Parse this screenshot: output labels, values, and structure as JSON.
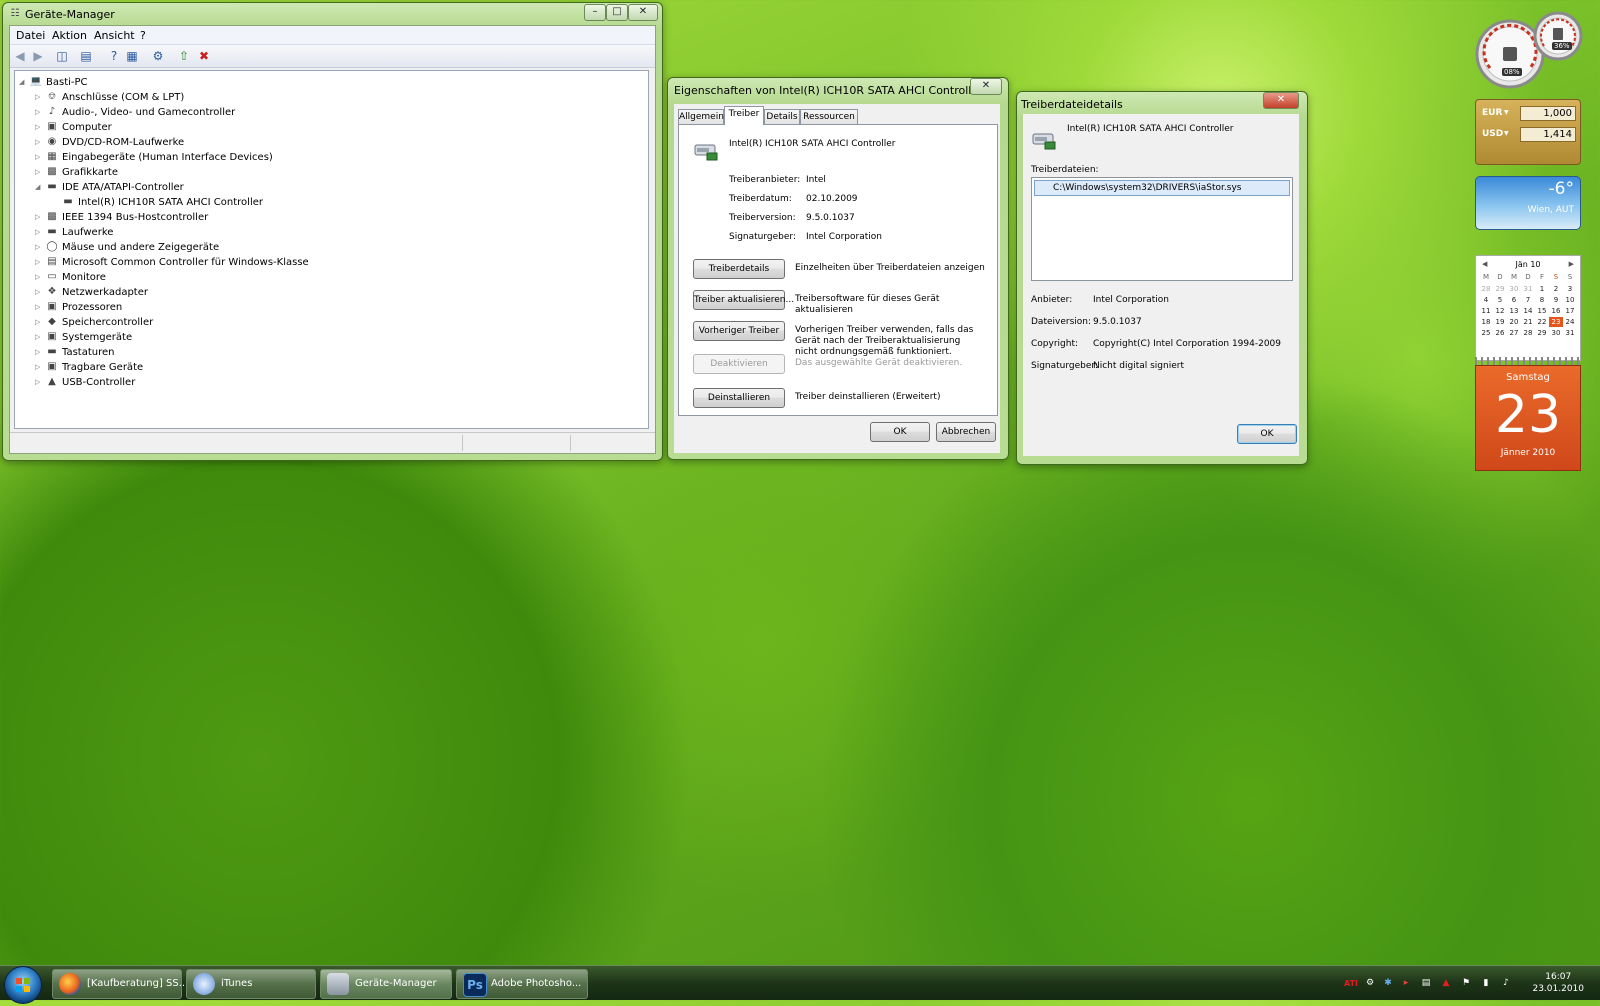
{
  "device_manager": {
    "title": "Geräte-Manager",
    "menu": [
      "Datei",
      "Aktion",
      "Ansicht",
      "?"
    ],
    "tree_root": "Basti-PC",
    "tree_items": [
      {
        "label": "Anschlüsse (COM & LPT)",
        "icon": "port-icon",
        "expanded": false
      },
      {
        "label": "Audio-, Video- und Gamecontroller",
        "icon": "speaker-icon",
        "expanded": false
      },
      {
        "label": "Computer",
        "icon": "computer-icon",
        "expanded": false
      },
      {
        "label": "DVD/CD-ROM-Laufwerke",
        "icon": "cd-drive-icon",
        "expanded": false
      },
      {
        "label": "Eingabegeräte (Human Interface Devices)",
        "icon": "hid-icon",
        "expanded": false
      },
      {
        "label": "Grafikkarte",
        "icon": "display-adapter-icon",
        "expanded": false
      },
      {
        "label": "IDE ATA/ATAPI-Controller",
        "icon": "ide-controller-icon",
        "expanded": true
      },
      {
        "label": "Intel(R) ICH10R SATA AHCI Controller",
        "icon": "ide-controller-icon",
        "child": true
      },
      {
        "label": "IEEE 1394 Bus-Hostcontroller",
        "icon": "firewire-icon",
        "expanded": false
      },
      {
        "label": "Laufwerke",
        "icon": "disk-drive-icon",
        "expanded": false
      },
      {
        "label": "Mäuse und andere Zeigegeräte",
        "icon": "mouse-icon",
        "expanded": false
      },
      {
        "label": "Microsoft Common Controller für Windows-Klasse",
        "icon": "controller-icon",
        "expanded": false
      },
      {
        "label": "Monitore",
        "icon": "monitor-icon",
        "expanded": false
      },
      {
        "label": "Netzwerkadapter",
        "icon": "network-icon",
        "expanded": false
      },
      {
        "label": "Prozessoren",
        "icon": "cpu-icon",
        "expanded": false
      },
      {
        "label": "Speichercontroller",
        "icon": "storage-controller-icon",
        "expanded": false
      },
      {
        "label": "Systemgeräte",
        "icon": "system-device-icon",
        "expanded": false
      },
      {
        "label": "Tastaturen",
        "icon": "keyboard-icon",
        "expanded": false
      },
      {
        "label": "Tragbare Geräte",
        "icon": "portable-device-icon",
        "expanded": false
      },
      {
        "label": "USB-Controller",
        "icon": "usb-icon",
        "expanded": false
      }
    ]
  },
  "properties": {
    "title": "Eigenschaften von Intel(R) ICH10R SATA AHCI Controller",
    "tabs": [
      "Allgemein",
      "Treiber",
      "Details",
      "Ressourcen"
    ],
    "active_tab": "Treiber",
    "device_name": "Intel(R) ICH10R SATA AHCI Controller",
    "fields": [
      {
        "label": "Treiberanbieter:",
        "value": "Intel"
      },
      {
        "label": "Treiberdatum:",
        "value": "02.10.2009"
      },
      {
        "label": "Treiberversion:",
        "value": "9.5.0.1037"
      },
      {
        "label": "Signaturgeber:",
        "value": "Intel Corporation"
      }
    ],
    "actions": [
      {
        "button": "Treiberdetails",
        "desc": "Einzelheiten über Treiberdateien anzeigen",
        "enabled": true
      },
      {
        "button": "Treiber aktualisieren...",
        "desc": "Treibersoftware für dieses Gerät aktualisieren",
        "enabled": true
      },
      {
        "button": "Vorheriger Treiber",
        "desc": "Vorherigen Treiber verwenden, falls das Gerät nach der Treiberaktualisierung nicht ordnungsgemäß funktioniert.",
        "enabled": true
      },
      {
        "button": "Deaktivieren",
        "desc": "Das ausgewählte Gerät deaktivieren.",
        "enabled": false
      },
      {
        "button": "Deinstallieren",
        "desc": "Treiber deinstallieren (Erweitert)",
        "enabled": true
      }
    ],
    "ok": "OK",
    "cancel": "Abbrechen"
  },
  "driver_details": {
    "title": "Treiberdateidetails",
    "device_name": "Intel(R) ICH10R SATA AHCI Controller",
    "files_label": "Treiberdateien:",
    "files": [
      "C:\\Windows\\system32\\DRIVERS\\iaStor.sys"
    ],
    "fields": [
      {
        "label": "Anbieter:",
        "value": "Intel Corporation"
      },
      {
        "label": "Dateiversion:",
        "value": "9.5.0.1037"
      },
      {
        "label": "Copyright:",
        "value": "Copyright(C) Intel Corporation 1994-2009"
      },
      {
        "label": "Signaturgeber:",
        "value": "Nicht digital signiert"
      }
    ],
    "ok": "OK"
  },
  "gadgets": {
    "cpu_meter": {
      "cpu": "08%",
      "memory": "36%"
    },
    "currency": [
      {
        "code": "EUR",
        "value": "1,000"
      },
      {
        "code": "USD",
        "value": "1,414"
      }
    ],
    "weather": {
      "temp": "-6°",
      "location": "Wien, AUT"
    },
    "calendar": {
      "month": "Jän 10",
      "weekdays": [
        "M",
        "D",
        "M",
        "D",
        "F",
        "S",
        "S"
      ],
      "weeks": [
        [
          "28",
          "29",
          "30",
          "31",
          "1",
          "2",
          "3"
        ],
        [
          "4",
          "5",
          "6",
          "7",
          "8",
          "9",
          "10"
        ],
        [
          "11",
          "12",
          "13",
          "14",
          "15",
          "16",
          "17"
        ],
        [
          "18",
          "19",
          "20",
          "21",
          "22",
          "23",
          "24"
        ],
        [
          "25",
          "26",
          "27",
          "28",
          "29",
          "30",
          "31"
        ]
      ],
      "today": "23",
      "day_name": "Samstag",
      "month_year": "Jänner 2010"
    }
  },
  "taskbar": {
    "tasks": [
      {
        "label": "[Kaufberatung] SS...",
        "icon": "firefox-icon"
      },
      {
        "label": "iTunes",
        "icon": "itunes-icon"
      },
      {
        "label": "Geräte-Manager",
        "icon": "device-manager-icon"
      },
      {
        "label": "Adobe Photosho...",
        "icon": "photoshop-icon",
        "icon_text": "Ps"
      }
    ],
    "time": "16:07",
    "date": "23.01.2010"
  },
  "colors": {
    "accent": "#3c7fb1",
    "calendar_orange": "#e4561c"
  }
}
